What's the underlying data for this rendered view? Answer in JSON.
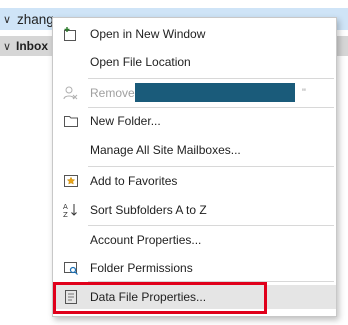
{
  "folder_pane": {
    "account_label": "zhang",
    "inbox_label": "Inbox"
  },
  "context_menu": {
    "items": [
      {
        "label": "Open in New Window",
        "icon": "new-window-icon"
      },
      {
        "label": "Open File Location",
        "icon": ""
      },
      {
        "label": "Remove",
        "icon": "remove-user-icon",
        "disabled": true,
        "trailing": "\""
      },
      {
        "label": "New Folder...",
        "icon": "folder-icon"
      },
      {
        "label": "Manage All Site Mailboxes...",
        "icon": ""
      },
      {
        "label": "Add to Favorites",
        "icon": "favorites-star-icon"
      },
      {
        "label": "Sort Subfolders A to Z",
        "icon": "sort-a-z-icon"
      },
      {
        "label": "Account Properties...",
        "icon": ""
      },
      {
        "label": "Folder Permissions",
        "icon": "folder-permissions-icon"
      },
      {
        "label": "Data File Properties...",
        "icon": "data-file-properties-icon",
        "highlighted": true
      }
    ]
  },
  "colors": {
    "selection_blue": "#cfe4f7",
    "highlight_red": "#e0001b",
    "redaction": "#1a5b7a"
  }
}
